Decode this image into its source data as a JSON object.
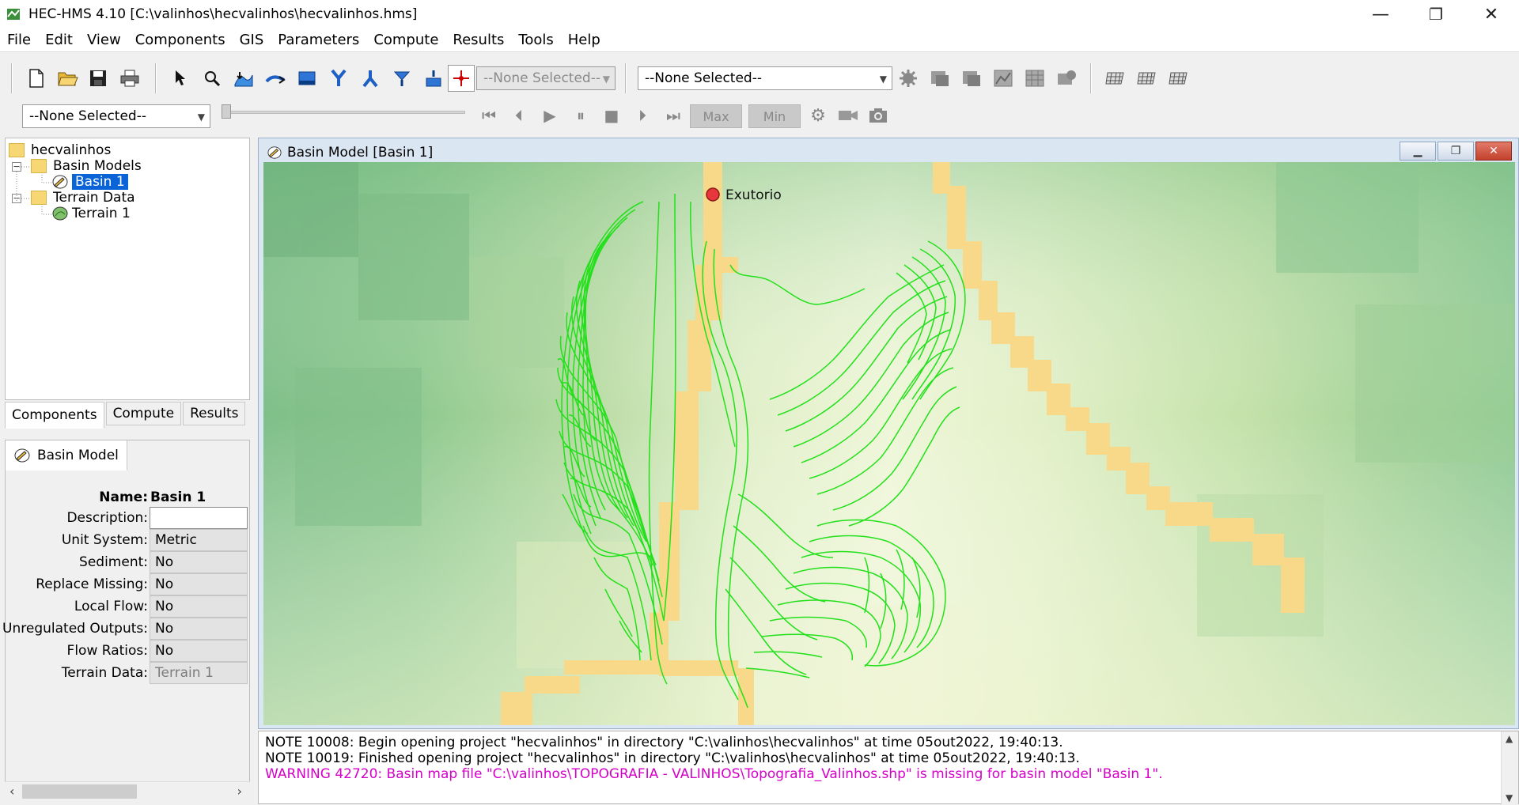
{
  "window": {
    "title": "HEC-HMS 4.10 [C:\\valinhos\\hecvalinhos\\hecvalinhos.hms]",
    "minimize": "—",
    "maximize": "❐",
    "close": "✕"
  },
  "menu": [
    "File",
    "Edit",
    "View",
    "Components",
    "GIS",
    "Parameters",
    "Compute",
    "Results",
    "Tools",
    "Help"
  ],
  "toolbar": {
    "element_combo": "--None Selected--",
    "run_combo": "--None Selected--",
    "time_combo": "--None Selected--",
    "max_label": "Max",
    "min_label": "Min"
  },
  "tree": {
    "root": "hecvalinhos",
    "basin_models": "Basin Models",
    "basin1": "Basin 1",
    "terrain_data": "Terrain Data",
    "terrain1": "Terrain 1"
  },
  "tabs": [
    "Components",
    "Compute",
    "Results"
  ],
  "properties": {
    "tab": "Basin Model",
    "name_label": "Name:",
    "name_value": "Basin 1",
    "rows": [
      {
        "label": "Description:",
        "value": ""
      },
      {
        "label": "Unit System:",
        "value": "Metric"
      },
      {
        "label": "Sediment:",
        "value": "No"
      },
      {
        "label": "Replace Missing:",
        "value": "No"
      },
      {
        "label": "Local Flow:",
        "value": "No"
      },
      {
        "label": "Unregulated Outputs:",
        "value": "No"
      },
      {
        "label": "Flow Ratios:",
        "value": "No"
      },
      {
        "label": "Terrain Data:",
        "value": "Terrain 1"
      }
    ]
  },
  "map": {
    "window_title": "Basin Model [Basin 1]",
    "outlet_label": "Exutorio",
    "contour_color": "#22e01a",
    "stream_color": "#f8d98a"
  },
  "console": [
    {
      "text": "NOTE 10008:  Begin opening project \"hecvalinhos\" in directory \"C:\\valinhos\\hecvalinhos\" at time 05out2022, 19:40:13.",
      "level": "note"
    },
    {
      "text": "NOTE 10019:  Finished opening project \"hecvalinhos\" in directory \"C:\\valinhos\\hecvalinhos\" at time 05out2022, 19:40:13.",
      "level": "note"
    },
    {
      "text": "WARNING 42720:  Basin map file \"C:\\valinhos\\TOPOGRAFIA - VALINHOS\\Topografia_Valinhos.shp\" is missing for basin model \"Basin 1\".",
      "level": "warning"
    }
  ]
}
